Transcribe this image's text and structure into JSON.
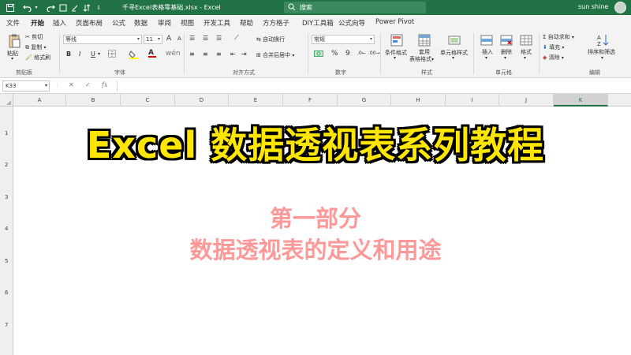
{
  "titlebar": {
    "title": "千寻Excel表格零基础.xlsx  -  Excel",
    "search_placeholder": "搜索",
    "user": "sun shine"
  },
  "ribbon_tabs": [
    "文件",
    "开始",
    "插入",
    "页面布局",
    "公式",
    "数据",
    "审阅",
    "视图",
    "开发工具",
    "帮助",
    "方方格子",
    "DIY工具箱",
    "公式向导",
    "Power Pivot"
  ],
  "ribbon": {
    "clipboard": {
      "paste": "粘贴",
      "cut": "剪切",
      "copy": "复制",
      "format_painter": "格式刷",
      "group": "剪贴板"
    },
    "font": {
      "font_name": "等线",
      "font_size": "11",
      "bold": "B",
      "italic": "I",
      "underline": "U",
      "grow": "A",
      "shrink": "A",
      "group": "字体"
    },
    "alignment": {
      "wrap": "自动换行",
      "merge": "合并后居中",
      "group": "对齐方式"
    },
    "number": {
      "format": "常规",
      "percent": "%",
      "comma": "9",
      "group": "数字"
    },
    "styles": {
      "conditional": "条件格式",
      "table": "套用\n表格格式",
      "table1": "套用",
      "table2": "表格格式",
      "cell": "单元格样式",
      "group": "样式"
    },
    "cells": {
      "insert": "插入",
      "delete": "删除",
      "format": "格式",
      "group": "单元格"
    },
    "editing": {
      "autosum": "自动求和",
      "fill": "填充",
      "clear": "清除",
      "sort": "排序和筛选",
      "group": "编辑"
    }
  },
  "formula_bar": {
    "cell_ref": "K33",
    "fx": "fx",
    "cancel": "✕",
    "enter": "✓"
  },
  "columns": [
    "A",
    "B",
    "C",
    "D",
    "E",
    "F",
    "G",
    "H",
    "I",
    "J",
    "K"
  ],
  "rows": [
    "1",
    "2",
    "3",
    "4",
    "5",
    "6",
    "7"
  ],
  "content": {
    "title": "Excel 数据透视表系列教程",
    "subtitle1": "第一部分",
    "subtitle2": "数据透视表的定义和用途"
  },
  "colors": {
    "excel_green": "#217346",
    "title_yellow": "#ffe600",
    "subtitle_pink": "#ff9999"
  }
}
